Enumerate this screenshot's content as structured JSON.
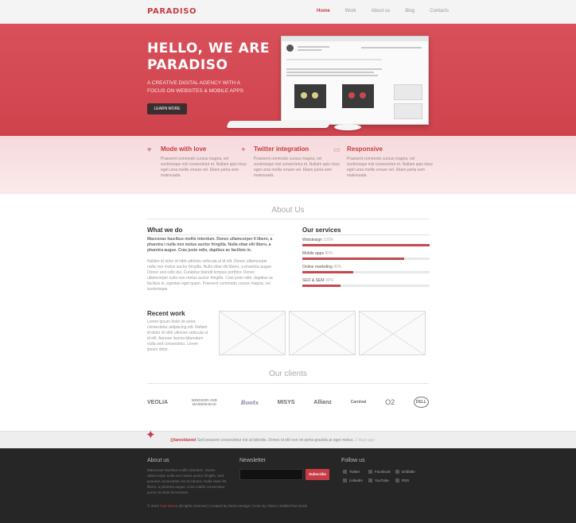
{
  "colors": {
    "accent": "#c73c45",
    "hero_bg": "#d14a54",
    "features_bg": "#f8e1e3",
    "footer_bg": "#262626"
  },
  "brand": "PARADISO",
  "nav": [
    {
      "label": "Home",
      "active": true
    },
    {
      "label": "Work",
      "active": false
    },
    {
      "label": "About us",
      "active": false
    },
    {
      "label": "Blog",
      "active": false
    },
    {
      "label": "Contacts",
      "active": false
    }
  ],
  "hero": {
    "title": "HELLO, WE ARE PARADISO",
    "subtitle": "A CREATIVE DIGITAL AGENCY WITH A FOCUS ON WEBSITES & MOBILE APPS",
    "button": "LEARN MORE"
  },
  "features": [
    {
      "icon": "heart-icon",
      "glyph": "♥",
      "title": "Mode with love",
      "text": "Praesent commodo cursus magna, vel scelerisque nisl consectetur et. Nullam quis risus eget urna mollis ornare vel. Etiam porta sem malesuada."
    },
    {
      "icon": "twitter-bird-icon",
      "glyph": "✦",
      "title": "Twitter integration",
      "text": "Praesent commodo cursus magna, vel scelerisque nisl consectetur et. Nullam quis risus eget urna mollis ornare vel. Etiam porta sem malesuada."
    },
    {
      "icon": "mobile-icon",
      "glyph": "▭",
      "title": "Responsive",
      "text": "Praesent commodo cursus magna, vel scelerisque nisl consectetur et. Nullam quis risus eget urna mollis ornare vel. Etiam porta sem malesuada."
    }
  ],
  "about": {
    "title": "About Us",
    "what_title": "What we do",
    "what_lead": "Maecenas faucibus mollis interdum. Donec ullamcorper ll libero, a pharetra i nulla non metus auctor fringilla. Nulla vitae elit libero, a pharetra augue. Cras justo odio, dapibus ac facilisis in.",
    "what_body": "Nullam id dolor id nibh ultricies vehicula ut id elit. Donec ullamcorper nulla non metus auctor fringilla. Nulla vitae elit libero, a pharetra augue. Donec sed odio dui. Curabitur blandit tempus porttitor. Donec ullamcorper nulla non metus auctor fringilla. Cras justo odio, dapibus ac facilisis in, egestas eget quam. Praesent commodo cursus magna, vel scelerisque.",
    "services_title": "Our services",
    "services": [
      {
        "label": "Webdesign",
        "value": "100%",
        "pct": 100
      },
      {
        "label": "Mobile apps",
        "value": "80%",
        "pct": 80
      },
      {
        "label": "Online marketing",
        "value": "40%",
        "pct": 40
      },
      {
        "label": "SEO & SEM",
        "value": "30%",
        "pct": 30
      }
    ],
    "recent_title": "Recent work",
    "recent_text": "Lorem ipsum dolor sit amet, consectetur adipiscing elit. Nullam id dolor id nibh ultricies vehicula ut id elit. Aenean lacinia bibendum nulla sed consectetur. Lorem ipsum dolor."
  },
  "clients": {
    "title": "Our clients",
    "logos": [
      "VEOLIA",
      "WINDSOR AND MAIDENHEAD",
      "Boots",
      "MISYS",
      "Allianz",
      "Carnival",
      "O2",
      "DELL"
    ]
  },
  "twitter": {
    "handle": "@lamoldaniel",
    "text": " Sed posuere consectetur est at lobortis. Donec id elit non mi porta gravida at eget metus.",
    "time": " 2 days ago"
  },
  "footer": {
    "about_title": "About us",
    "about_text": "Maecenas faucibus mollis interdum. Donec ullamcorper nulla non metus auctor fringilla. Sed posuere consectetur est at lobortis. Nulla vitae elit libero, a pharetra augue. Cras mattis consectetur purus sit amet fermentum.",
    "newsletter_title": "Newsletter",
    "subscribe": "Subscribe",
    "follow_title": "Follow us",
    "social": [
      "Twitter",
      "Facebook",
      "Dribbble",
      "LinkedIn",
      "YouTube",
      "RSS"
    ],
    "copyright_pre": "© 2013 ",
    "copyright_brand": "Your Name",
    "copyright_post": " all rights reserved | Created by Demo Design | Icons by Vimeo | Edited font Dosis"
  }
}
